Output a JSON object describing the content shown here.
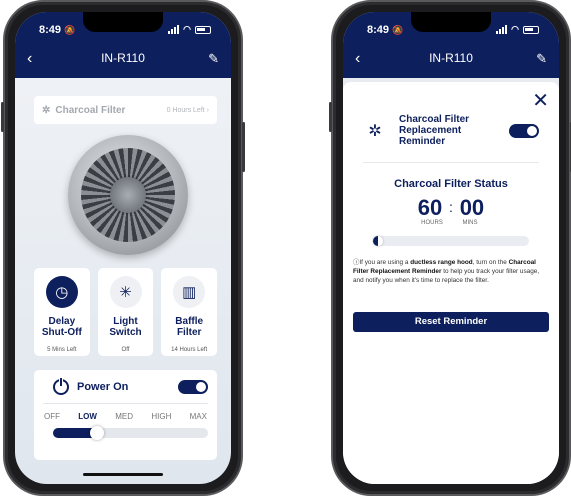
{
  "status_bar": {
    "time": "8:49"
  },
  "screen1": {
    "header": {
      "title": "IN-R110",
      "back_icon": "chevron-left-icon",
      "edit_icon": "edit-pencil-icon"
    },
    "filter": {
      "label": "Charcoal Filter",
      "hours_left": "0 Hours Left"
    },
    "tiles": [
      {
        "name_line1": "Delay",
        "name_line2": "Shut-Off",
        "sub": "5 Mins Left",
        "icon": "clock-icon"
      },
      {
        "name_line1": "Light",
        "name_line2": "Switch",
        "sub": "Off",
        "icon": "light-icon"
      },
      {
        "name_line1": "Baffle",
        "name_line2": "Filter",
        "sub": "14 Hours Left",
        "icon": "baffle-filter-icon"
      }
    ],
    "power": {
      "label": "Power On",
      "on": true,
      "speeds": [
        "OFF",
        "LOW",
        "MED",
        "HIGH",
        "MAX"
      ],
      "selected_speed": "LOW",
      "speed_level": 0.25
    }
  },
  "screen2": {
    "header": {
      "title": "IN-R110",
      "back_icon": "chevron-left-icon",
      "edit_icon": "edit-pencil-icon"
    },
    "reminder": {
      "line1": "Charcoal Filter",
      "line2": "Replacement",
      "line3": "Reminder",
      "enabled": true
    },
    "status_title": "Charcoal Filter Status",
    "timer": {
      "hours": "60",
      "mins": "00",
      "hours_label": "HOURS",
      "mins_label": "MINS"
    },
    "slider_level": 0.0,
    "info": {
      "prefix": "If you are using a ",
      "bold1": "ductless range hood",
      "mid": ", turn on the ",
      "bold2": "Charcoal Filter Replacement Reminder",
      "suffix": " to help you track your filter usage, and notify you when it's time to replace the filter."
    },
    "reset_label": "Reset Reminder"
  },
  "colors": {
    "brand_navy": "#0d1f5c"
  }
}
